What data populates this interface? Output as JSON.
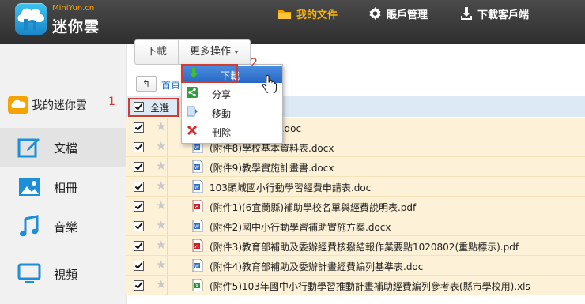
{
  "header": {
    "logo_sub": "MiniYun.cn",
    "logo_title": "迷你雲",
    "nav": [
      {
        "label": "我的文件",
        "icon": "folder-icon"
      },
      {
        "label": "賬戶管理",
        "icon": "gear-icon"
      },
      {
        "label": "下載客戶端",
        "icon": "download-icon"
      }
    ]
  },
  "sidebar": {
    "cloud_label": "我的迷你雲",
    "items": [
      {
        "label": "文檔",
        "icon": "document-edit-icon"
      },
      {
        "label": "相冊",
        "icon": "photo-icon"
      },
      {
        "label": "音樂",
        "icon": "music-note-icon"
      },
      {
        "label": "視頻",
        "icon": "monitor-icon"
      }
    ]
  },
  "toolbar": {
    "download_label": "下載",
    "more_label": "更多操作"
  },
  "breadcrumb": {
    "back": "↰",
    "text": "首頁"
  },
  "list": {
    "select_all_label": "全選",
    "files": [
      {
        "name": "表(含範例)(縣市).doc",
        "type": "word"
      },
      {
        "name": "(附件8)學校基本資料表.docx",
        "type": "word"
      },
      {
        "name": "(附件9)教學實施計畫書.docx",
        "type": "word"
      },
      {
        "name": "103頭城國小行動學習經費申請表.doc",
        "type": "word"
      },
      {
        "name": "(附件1)(6宜蘭縣)補助學校名單與經費說明表.pdf",
        "type": "pdf"
      },
      {
        "name": "(附件2)國中小行動學習補助實施方案.docx",
        "type": "word"
      },
      {
        "name": "(附件3)教育部補助及委辦經費核撥結報作業要點1020802(重點標示).pdf",
        "type": "pdf"
      },
      {
        "name": "(附件4)教育部補助及委辦計畫經費編列基準表.doc",
        "type": "word"
      },
      {
        "name": "(附件5)103年國中小行動學習推動計畫補助經費編列參考表(縣市學校用).xls",
        "type": "excel"
      }
    ]
  },
  "menu": {
    "items": [
      {
        "label": "下載",
        "icon": "download-arrow-icon"
      },
      {
        "label": "分享",
        "icon": "share-icon"
      },
      {
        "label": "移動",
        "icon": "move-icon"
      },
      {
        "label": "刪除",
        "icon": "delete-x-icon"
      }
    ]
  },
  "annotations": {
    "step1": "1",
    "step2": "2"
  },
  "colors": {
    "accent": "#ffb400",
    "highlight": "#2867c5",
    "annotation": "#d63b2f",
    "row_bg": "#fdf1d7"
  }
}
